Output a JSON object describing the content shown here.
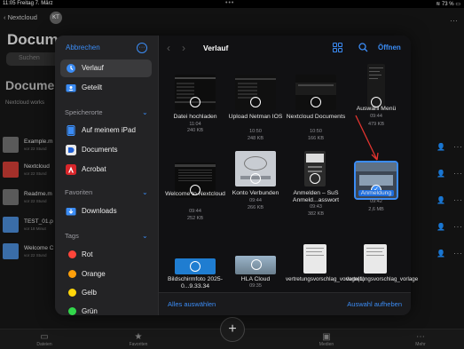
{
  "status_bar": {
    "time": "11:05",
    "date": "Freitag 7. März",
    "battery": "73 %"
  },
  "background_app": {
    "back_label": "Nextcloud",
    "avatar_initials": "KT",
    "title": "Docum",
    "search_placeholder": "Suchen",
    "subtitle": "Documen",
    "subtitle_caption": "Nextcloud works",
    "rows": [
      {
        "name": "Example.m",
        "sub": "vor 22 Stund",
        "color": "#5a5a5a"
      },
      {
        "name": "Nextcloud",
        "sub": "vor 22 Stund",
        "color": "#a3302a"
      },
      {
        "name": "Readme.m",
        "sub": "vor 22 Stund",
        "color": "#5a5a5a"
      },
      {
        "name": "TEST_01.p",
        "sub": "vor 18 Minut",
        "color": "#3a6da8"
      },
      {
        "name": "Welcome C",
        "sub": "vor 22 Stund",
        "color": "#3a6da8"
      }
    ],
    "tabs": [
      "Dateien",
      "Favoriten",
      "Medien",
      "Mehr"
    ]
  },
  "sidebar": {
    "cancel_label": "Abbrechen",
    "recents_label": "Verlauf",
    "shared_label": "Geteilt",
    "locations_header": "Speicherorte",
    "locations": [
      "Auf meinem iPad",
      "Documents",
      "Acrobat"
    ],
    "favorites_header": "Favoriten",
    "favorites": [
      "Downloads"
    ],
    "tags_header": "Tags",
    "tags": [
      {
        "label": "Rot",
        "color": "#ff453a"
      },
      {
        "label": "Orange",
        "color": "#ff9f0a"
      },
      {
        "label": "Gelb",
        "color": "#ffd60a"
      },
      {
        "label": "Grün",
        "color": "#32d74b"
      }
    ]
  },
  "content": {
    "title": "Verlauf",
    "open_label": "Öffnen",
    "select_all_label": "Alles auswählen",
    "deselect_label": "Auswahl aufheben",
    "files": [
      {
        "name": "Datei hochladen",
        "time": "11:04",
        "size": "240 KB"
      },
      {
        "name": "Upload Netman IOS",
        "time": "10:50",
        "size": "248 KB"
      },
      {
        "name": "Nextcloud Documents",
        "time": "10:50",
        "size": "166 KB"
      },
      {
        "name": "Auswahl Menü",
        "time": "09:44",
        "size": "479 KB"
      },
      {
        "name": "Welcome to Nextcloud",
        "time": "09:44",
        "size": "252 KB"
      },
      {
        "name": "Konto Verbunden",
        "time": "09:44",
        "size": "266 KB"
      },
      {
        "name": "Anmelden – SuS Anmeld...asswort",
        "time": "09:43",
        "size": "382 KB"
      },
      {
        "name": "Anmeldung",
        "time": "09:42",
        "size": "2,6 MB"
      },
      {
        "name": "Bildschirmfoto 2025-0...9.33.34",
        "time": "",
        "size": ""
      },
      {
        "name": "HLA Cloud",
        "time": "09:35",
        "size": ""
      },
      {
        "name": "vertretungsvorschlag_vorlage(1)",
        "time": "",
        "size": ""
      },
      {
        "name": "vertretungsvorschlag_vorlage",
        "time": "",
        "size": ""
      }
    ]
  },
  "colors": {
    "accent": "#3b8cf5",
    "selection": "#1f6fe0",
    "annotation_arrow": "#e3342f"
  }
}
